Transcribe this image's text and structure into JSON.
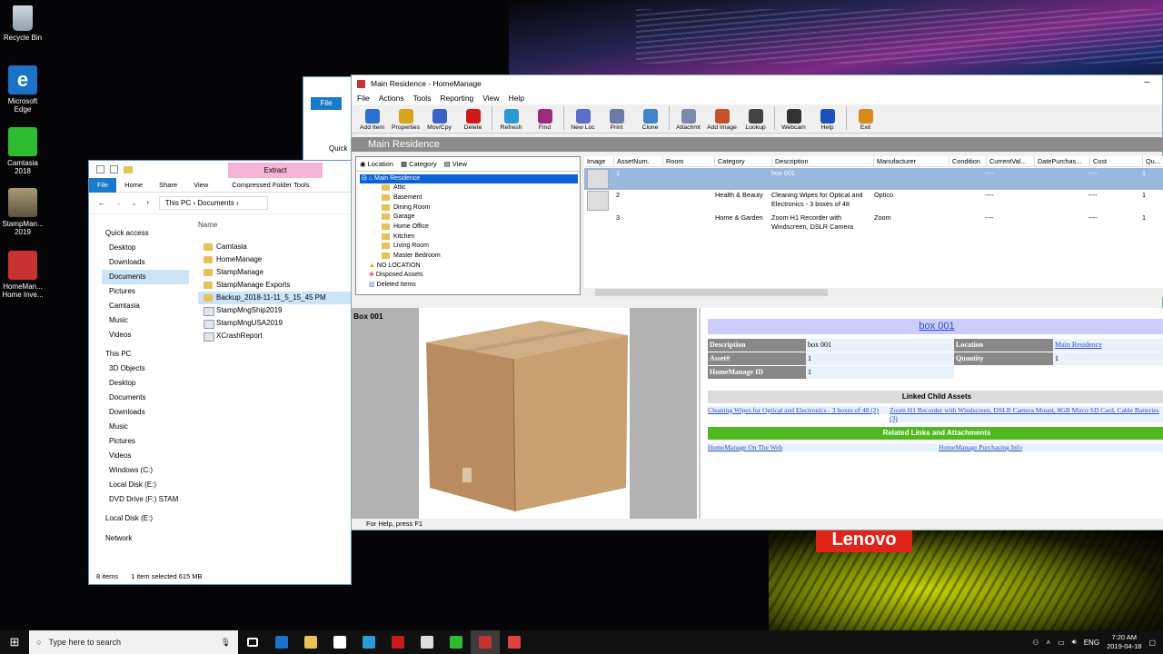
{
  "desktop": {
    "icons": [
      {
        "label": "Recycle Bin"
      },
      {
        "label": "Microsoft Edge"
      },
      {
        "label": "Camtasia 2018"
      },
      {
        "label": "StampMan... 2019"
      },
      {
        "label": "HomeMan... Home Inve..."
      }
    ],
    "wallpaper_brand": "Lenovo"
  },
  "explorer": {
    "context_tab": "Extract",
    "context_group": "Compressed Folder Tools",
    "ribbon": [
      "File",
      "Home",
      "Share",
      "View"
    ],
    "breadcrumb": [
      "This PC",
      "Documents"
    ],
    "column_name": "Name",
    "nav": [
      "Quick access",
      "Desktop",
      "Downloads",
      "Documents",
      "Pictures",
      "Camtasia",
      "Music",
      "Videos",
      "This PC",
      "3D Objects",
      "Desktop",
      "Documents",
      "Downloads",
      "Music",
      "Pictures",
      "Videos",
      "Windows (C:)",
      "Local Disk (E:)",
      "DVD Drive (F:) STAM",
      "Local Disk (E:)",
      "Network"
    ],
    "files": [
      "Camtasia",
      "HomeManage",
      "StampManage",
      "StampManage Exports",
      "Backup_2018-11-11_5_15_45 PM",
      "StampMngShip2019",
      "StampMngUSA2019",
      "XCrashReport"
    ],
    "status_items": "8 items",
    "status_selected": "1 item selected  615 MB"
  },
  "background_window": {
    "file_tab": "File",
    "quick": "Quick"
  },
  "homemanage": {
    "title": "Main Residence - HomeManage",
    "menu": [
      "File",
      "Actions",
      "Tools",
      "Reporting",
      "View",
      "Help"
    ],
    "toolbar": [
      {
        "label": "Add Item",
        "color": "#2c6fd1"
      },
      {
        "label": "Properties",
        "color": "#d9a21b"
      },
      {
        "label": "Mov/Cpy",
        "color": "#3b62c9"
      },
      {
        "label": "Delete",
        "color": "#d01818"
      },
      {
        "label": "Refresh",
        "color": "#2a9ad6"
      },
      {
        "label": "Find",
        "color": "#9c2c7a"
      },
      {
        "label": "New Loc",
        "color": "#5a6ec8"
      },
      {
        "label": "Print",
        "color": "#6c7aa8"
      },
      {
        "label": "Clone",
        "color": "#3e86c8"
      },
      {
        "label": "Attachmt",
        "color": "#7a8aa8"
      },
      {
        "label": "Add Image",
        "color": "#c8502a"
      },
      {
        "label": "Lookup",
        "color": "#444444"
      },
      {
        "label": "Webcam",
        "color": "#333333"
      },
      {
        "label": "Help",
        "color": "#2050c0"
      },
      {
        "label": "Exit",
        "color": "#d98a1b"
      }
    ],
    "header": "Main Residence",
    "tree_tabs": [
      "Location",
      "Category",
      "View"
    ],
    "tree": {
      "root": "Main Residence",
      "children": [
        "Attic",
        "Basement",
        "Dining Room",
        "Garage",
        "Home Office",
        "Kitchen",
        "Living Room",
        "Master Bedroom"
      ],
      "others": [
        "NO LOCATION",
        "Disposed Assets",
        "Deleted Items"
      ]
    },
    "grid_columns": [
      "Image",
      "AssetNum.",
      "Room",
      "Category",
      "Description",
      "Manufacturer",
      "Condition",
      "CurrentVal...",
      "DatePurchas...",
      "Cost",
      "Qu..."
    ],
    "grid_rows": [
      {
        "num": "1",
        "room": "",
        "category": "",
        "description": "box 001",
        "manufacturer": "",
        "current": "----",
        "cost": "----",
        "qty": "1"
      },
      {
        "num": "2",
        "room": "",
        "category": "Health & Beauty",
        "description": "Cleaning Wipes for Optical and Electronics - 3 boxes of 48",
        "manufacturer": "Optico",
        "current": "----",
        "cost": "----",
        "qty": "1"
      },
      {
        "num": "3",
        "room": "",
        "category": "Home & Garden",
        "description": "Zoom H1 Recorder with Windscreen, DSLR Camera Mount, 8GB Mirco SD Card",
        "manufacturer": "Zoom",
        "current": "----",
        "cost": "----",
        "qty": "1"
      }
    ],
    "image_label": "Box 001",
    "detail": {
      "title": "box 001",
      "description_label": "Description",
      "description": "box 001",
      "location_label": "Location",
      "location": "Main Residence",
      "asset_label": "Asset#",
      "asset": "1",
      "quantity_label": "Quantity",
      "quantity": "1",
      "id_label": "HomeManage ID",
      "id": "1",
      "linked_header": "Linked Child Assets",
      "linked": [
        "Cleaning Wipes for Optical and Electronics - 3 boxes of 48 (2)",
        "Zoom H1 Recorder with Windscreen, DSLR Camera Mount, 8GB Mirco SD Card, Cable Batteries (3)"
      ],
      "related_header": "Related Links and Attachments",
      "related": [
        "HomeManage On The Web",
        "HomeManage Purchasing Info"
      ],
      "related_color": "#4fb81e",
      "linked_color": "#dcdcdc"
    },
    "status": "For Help, press F1"
  },
  "taskbar": {
    "search_placeholder": "Type here to search",
    "lang": "ENG",
    "time": "7:20 AM",
    "date": "2019-04-18"
  }
}
